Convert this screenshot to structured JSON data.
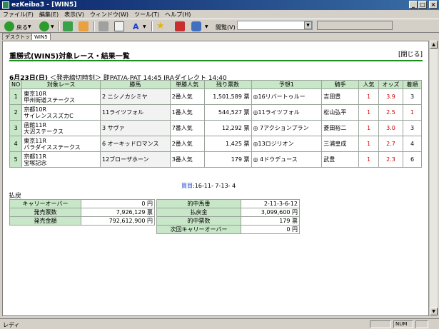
{
  "window": {
    "title": "ezKeiba3 - [WIN5]"
  },
  "menu": [
    "ファイル(F)",
    "編集(E)",
    "表示(V)",
    "ウィンドウ(W)",
    "ツール(T)",
    "ヘルプ(H)"
  ],
  "toolbar": {
    "back_label": "戻る",
    "addr_label": "閲覧(V)"
  },
  "tabs": [
    "デスクトップ",
    "WIN5"
  ],
  "page": {
    "title": "重勝式(WIN5)対象レース・結果一覧",
    "close_label": "[閉じる]",
    "date": "6月23日(日)",
    "deadline": "＜発売締切時刻＞ 即PAT/A-PAT 14:45 JRAダイレクト 14:40"
  },
  "race_table": {
    "headers": [
      "NO",
      "対象レース",
      "勝馬",
      "単勝人気",
      "残り票数",
      "予想1",
      "騎手",
      "人気",
      "オッズ",
      "着順"
    ],
    "rows": [
      {
        "no": "1",
        "race1": "東京10R",
        "race2": "甲州街道ステークス",
        "winner": "2 ニシノカシミヤ",
        "pop": "2番人気",
        "votes": "1,501,589 票",
        "pred": "◎16リバートゥルー",
        "jockey": "吉田豊",
        "p_pop": "1",
        "odds": "3.9",
        "rank": "3"
      },
      {
        "no": "2",
        "race1": "京都10R",
        "race2": "サイレンススズカC",
        "winner": "11ライツフォル",
        "pop": "1番人気",
        "votes": "544,527 票",
        "pred": "◎11ライツフォル",
        "jockey": "松山弘平",
        "p_pop": "1",
        "odds": "2.5",
        "rank": "1"
      },
      {
        "no": "3",
        "race1": "函館11R",
        "race2": "大沼ステークス",
        "winner": "3 サヴァ",
        "pop": "7番人気",
        "votes": "12,292 票",
        "pred": "◎ 7アクションプラン",
        "jockey": "菱田裕二",
        "p_pop": "1",
        "odds": "3.0",
        "rank": "3"
      },
      {
        "no": "4",
        "race1": "東京11R",
        "race2": "パラダイスステークス",
        "winner": "6 オーキッドロマンス",
        "pop": "2番人気",
        "votes": "1,425 票",
        "pred": "◎13ロジリオン",
        "jockey": "三浦皇成",
        "p_pop": "1",
        "odds": "2.7",
        "rank": "4"
      },
      {
        "no": "5",
        "race1": "京都11R",
        "race2": "宝塚記念",
        "winner": "12ブローザホーン",
        "pop": "3番人気",
        "votes": "179 票",
        "pred": "◎ 4ドウデュース",
        "jockey": "武豊",
        "p_pop": "1",
        "odds": "2.3",
        "rank": "6"
      }
    ]
  },
  "kaime": {
    "label": "買目",
    "value": ":16-11- 7-13- 4"
  },
  "payout": {
    "label": "払戻",
    "left": [
      {
        "label": "キャリーオーバー",
        "value": "0 円"
      },
      {
        "label": "発売票数",
        "value": "7,926,129 票"
      },
      {
        "label": "発売金額",
        "value": "792,612,900 円"
      }
    ],
    "right": [
      {
        "label": "的中馬番",
        "value": "2-11-3-6-12"
      },
      {
        "label": "払戻金",
        "value": "3,099,600 円"
      },
      {
        "label": "的中票数",
        "value": "179 票"
      },
      {
        "label": "次回キャリーオーバー",
        "value": "0 円"
      }
    ]
  },
  "status": {
    "left": "レディ",
    "num": "NUM"
  }
}
